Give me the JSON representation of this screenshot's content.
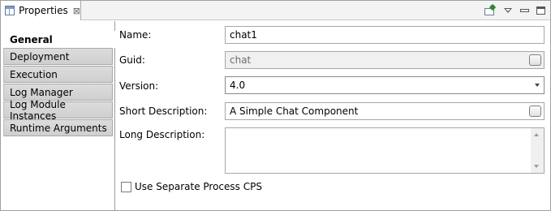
{
  "tab": {
    "title": "Properties",
    "close_glyph": "⊠"
  },
  "toolbar": {
    "icons": [
      "pin-icon",
      "view-menu-icon",
      "minimize-icon",
      "maximize-icon"
    ]
  },
  "sidebar": {
    "items": [
      {
        "label": "General",
        "active": true
      },
      {
        "label": "Deployment",
        "active": false
      },
      {
        "label": "Execution",
        "active": false
      },
      {
        "label": "Log Manager",
        "active": false
      },
      {
        "label": "Log Module Instances",
        "active": false
      },
      {
        "label": "Runtime Arguments",
        "active": false
      }
    ]
  },
  "form": {
    "name": {
      "label": "Name:",
      "value": "chat1"
    },
    "guid": {
      "label": "Guid:",
      "value": "chat",
      "disabled": true
    },
    "version": {
      "label": "Version:",
      "value": "4.0"
    },
    "short_description": {
      "label": "Short Description:",
      "value": "A Simple Chat Component"
    },
    "long_description": {
      "label": "Long Description:",
      "value": ""
    },
    "separate_process": {
      "label": "Use Separate Process CPS",
      "checked": false
    }
  }
}
